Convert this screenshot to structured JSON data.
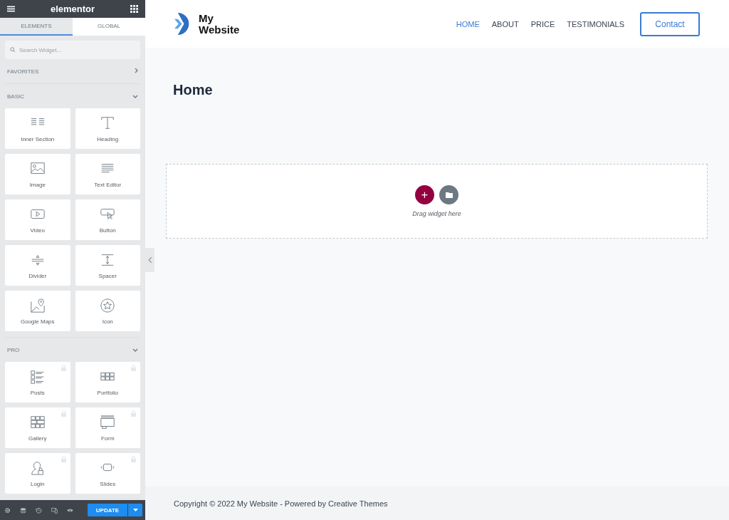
{
  "editor": {
    "brand": "elementor",
    "tabs": [
      {
        "label": "ELEMENTS",
        "selected": true
      },
      {
        "label": "GLOBAL",
        "selected": false
      }
    ],
    "search": {
      "placeholder": "Search Widget..."
    },
    "sections": [
      {
        "title": "FAVORITES",
        "expanded": false
      },
      {
        "title": "BASIC",
        "expanded": true,
        "widgets": [
          {
            "label": "Inner Section",
            "locked": false
          },
          {
            "label": "Heading",
            "locked": false
          },
          {
            "label": "Image",
            "locked": false
          },
          {
            "label": "Text Editor",
            "locked": false
          },
          {
            "label": "Video",
            "locked": false
          },
          {
            "label": "Button",
            "locked": false
          },
          {
            "label": "Divider",
            "locked": false
          },
          {
            "label": "Spacer",
            "locked": false
          },
          {
            "label": "Google Maps",
            "locked": false
          },
          {
            "label": "Icon",
            "locked": false
          }
        ]
      },
      {
        "title": "PRO",
        "expanded": true,
        "widgets": [
          {
            "label": "Posts",
            "locked": true
          },
          {
            "label": "Portfolio",
            "locked": true
          },
          {
            "label": "Gallery",
            "locked": true
          },
          {
            "label": "Form",
            "locked": true
          },
          {
            "label": "Login",
            "locked": true
          },
          {
            "label": "Slides",
            "locked": true
          }
        ]
      }
    ],
    "update_button": "UPDATE"
  },
  "site": {
    "logo_text": [
      "My",
      "Website"
    ],
    "nav": [
      {
        "label": "HOME",
        "selected": true
      },
      {
        "label": "ABOUT",
        "selected": false
      },
      {
        "label": "PRICE",
        "selected": false
      },
      {
        "label": "TESTIMONIALS",
        "selected": false
      }
    ],
    "contact_button": "Contact",
    "page_title": "Home",
    "drop_zone": {
      "hint": "Drag widget here",
      "plus": "+"
    },
    "footer": "Copyright © 2022 My Website - Powered by Creative Themes"
  }
}
